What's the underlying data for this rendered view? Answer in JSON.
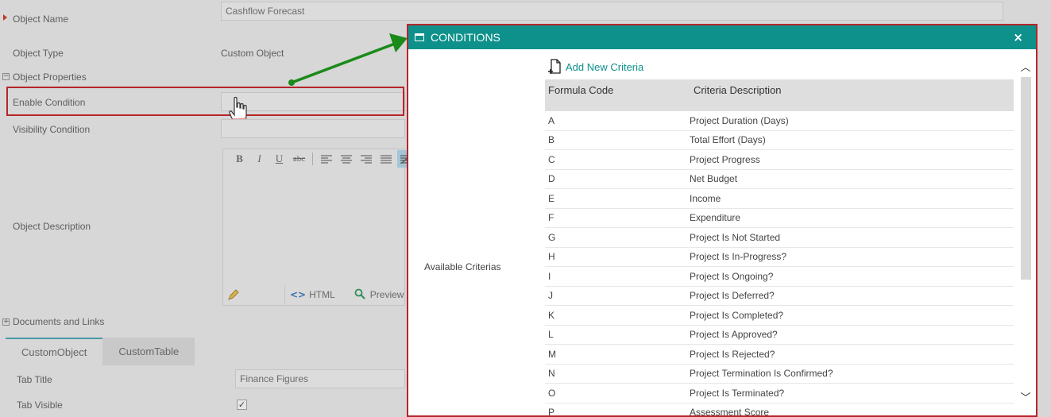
{
  "form": {
    "object_name_label": "Object Name",
    "object_name_value": "Cashflow Forecast",
    "object_type_label": "Object Type",
    "object_type_value": "Custom Object",
    "object_properties_label": "Object Properties",
    "enable_condition_label": "Enable Condition",
    "visibility_condition_label": "Visibility Condition",
    "object_description_label": "Object Description",
    "documents_links_label": "Documents and Links",
    "editor": {
      "bold": "B",
      "italic": "I",
      "underline": "U",
      "strike": "abc",
      "html_label": "HTML",
      "preview_label": "Preview"
    },
    "tabs": [
      "CustomObject",
      "CustomTable"
    ],
    "tab_title_label": "Tab Title",
    "tab_title_value": "Finance Figures",
    "tab_visible_label": "Tab Visible",
    "tab_visible_checked": "✓"
  },
  "modal": {
    "title": "CONDITIONS",
    "close": "×",
    "available_label": "Available Criterias",
    "add_criteria": "Add New Criteria",
    "columns": [
      "Formula Code",
      "Criteria Description"
    ],
    "rows": [
      {
        "code": "A",
        "desc": "Project Duration (Days)"
      },
      {
        "code": "B",
        "desc": "Total Effort (Days)"
      },
      {
        "code": "C",
        "desc": "Project Progress"
      },
      {
        "code": "D",
        "desc": "Net Budget"
      },
      {
        "code": "E",
        "desc": "Income"
      },
      {
        "code": "F",
        "desc": "Expenditure"
      },
      {
        "code": "G",
        "desc": "Project Is Not Started"
      },
      {
        "code": "H",
        "desc": "Project Is In-Progress?"
      },
      {
        "code": "I",
        "desc": "Project Is Ongoing?"
      },
      {
        "code": "J",
        "desc": "Project Is Deferred?"
      },
      {
        "code": "K",
        "desc": "Project Is Completed?"
      },
      {
        "code": "L",
        "desc": "Project Is Approved?"
      },
      {
        "code": "M",
        "desc": "Project Is Rejected?"
      },
      {
        "code": "N",
        "desc": "Project Termination Is Confirmed?"
      },
      {
        "code": "O",
        "desc": "Project Is Terminated?"
      },
      {
        "code": "P",
        "desc": "Assessment Score"
      }
    ]
  },
  "colors": {
    "accent": "#0e918b",
    "highlight": "#b5262b",
    "arrow": "#1a8a1a"
  }
}
